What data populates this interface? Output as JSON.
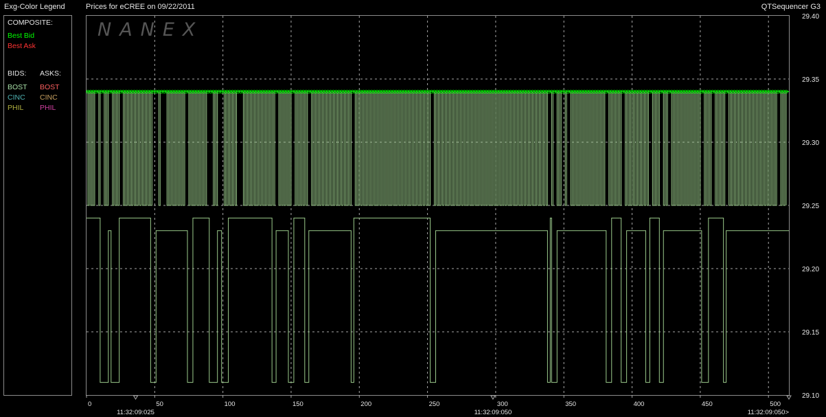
{
  "header": {
    "legend_title": "Exg-Color Legend",
    "chart_title": "Prices for  eCREE  on  09/22/2011",
    "app_name": "QTSequencer G3"
  },
  "watermark": "NANEX",
  "legend": {
    "composite_label": "COMPOSITE:",
    "best_bid": "Best Bid",
    "best_ask": "Best Ask",
    "bids_label": "BIDS:",
    "asks_label": "ASKS:",
    "bids": [
      "BOST",
      "CINC",
      "PHIL"
    ],
    "asks": [
      "BOST",
      "CINC",
      "PHIL"
    ]
  },
  "colors": {
    "best_bid": "#00ff00",
    "best_ask": "#ff3333",
    "bost_bid": "#a8e0a8",
    "cinc_bid": "#4fb3b3",
    "phil_bid": "#b0b040",
    "bost_ask": "#ff6060",
    "cinc_ask": "#c8a060",
    "phil_ask": "#d040a0",
    "series_line": "#9ccc8c",
    "grid": "#a8a8a8",
    "axis_text": "#e6e6e6"
  },
  "chart_data": {
    "type": "line",
    "x_ticks": [
      0,
      50,
      100,
      150,
      200,
      250,
      300,
      350,
      400,
      450,
      500
    ],
    "xlim": [
      0,
      515
    ],
    "time_labels": [
      {
        "x": 36,
        "label": "11:32:09:025"
      },
      {
        "x": 298,
        "label": "11:32:09:050"
      },
      {
        "x": 515,
        "label": "11:32:09:050>"
      }
    ],
    "y_ticks": [
      29.1,
      29.15,
      29.2,
      29.25,
      29.3,
      29.35,
      29.4
    ],
    "y_tick_labels": [
      "29.10",
      "29.15",
      "29.20",
      "29.25",
      "29.30",
      "29.35",
      "29.40"
    ],
    "ylim": [
      29.1,
      29.4
    ],
    "grid": true,
    "legend_position": "left-panel",
    "series": [
      {
        "key": "upper",
        "high": 29.34,
        "low": 29.25,
        "alternating_from": 0,
        "alternating_to": 515,
        "step_x": 1,
        "dense_to": 513,
        "gaps": [
          [
            6,
            8
          ],
          [
            10,
            12
          ],
          [
            16,
            19
          ],
          [
            24,
            26
          ],
          [
            49,
            52
          ],
          [
            55,
            58
          ],
          [
            72,
            75
          ],
          [
            89,
            92
          ],
          [
            97,
            100
          ],
          [
            111,
            114
          ],
          [
            138,
            141
          ],
          [
            150,
            152
          ],
          [
            162,
            164
          ],
          [
            195,
            197
          ],
          [
            252,
            254
          ],
          [
            338,
            340
          ],
          [
            343,
            345
          ],
          [
            349,
            351
          ],
          [
            353,
            355
          ],
          [
            381,
            383
          ],
          [
            393,
            395
          ],
          [
            412,
            414
          ],
          [
            421,
            423
          ],
          [
            427,
            429
          ],
          [
            450,
            452
          ],
          [
            458,
            460
          ],
          [
            469,
            471
          ],
          [
            506,
            508
          ]
        ],
        "markers_step": 2
      },
      {
        "key": "lower",
        "steps": [
          [
            0,
            29.24
          ],
          [
            10,
            29.11
          ],
          [
            16,
            29.23
          ],
          [
            18,
            29.11
          ],
          [
            24,
            29.24
          ],
          [
            47,
            29.11
          ],
          [
            51,
            29.23
          ],
          [
            74,
            29.11
          ],
          [
            78,
            29.24
          ],
          [
            90,
            29.11
          ],
          [
            96,
            29.23
          ],
          [
            99,
            29.11
          ],
          [
            104,
            29.24
          ],
          [
            136,
            29.11
          ],
          [
            139,
            29.23
          ],
          [
            148,
            29.11
          ],
          [
            152,
            29.24
          ],
          [
            160,
            29.11
          ],
          [
            163,
            29.23
          ],
          [
            194,
            29.11
          ],
          [
            196,
            29.24
          ],
          [
            252,
            29.11
          ],
          [
            256,
            29.23
          ],
          [
            338,
            29.11
          ],
          [
            340,
            29.24
          ],
          [
            341,
            29.11
          ],
          [
            345,
            29.23
          ],
          [
            381,
            29.11
          ],
          [
            385,
            29.24
          ],
          [
            392,
            29.11
          ],
          [
            396,
            29.23
          ],
          [
            410,
            29.11
          ],
          [
            413,
            29.24
          ],
          [
            420,
            29.11
          ],
          [
            423,
            29.23
          ],
          [
            451,
            29.11
          ],
          [
            456,
            29.24
          ],
          [
            467,
            29.11
          ],
          [
            469,
            29.23
          ],
          [
            515,
            29.23
          ]
        ]
      }
    ]
  }
}
